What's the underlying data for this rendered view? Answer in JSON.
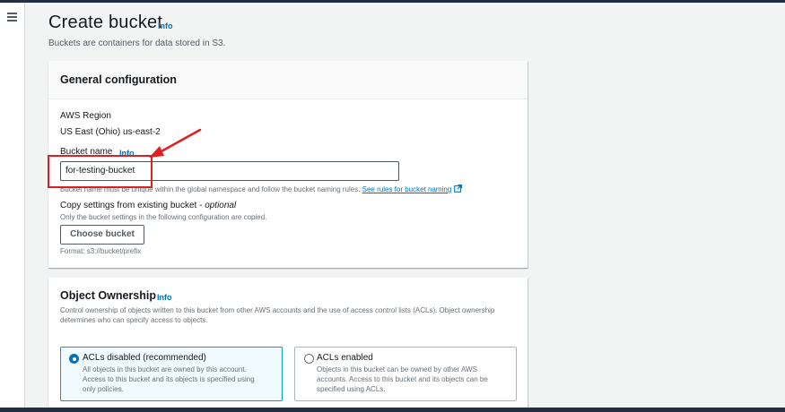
{
  "page": {
    "title": "Create bucket",
    "title_info": "Info",
    "description": "Buckets are containers for data stored in S3."
  },
  "general": {
    "heading": "General configuration",
    "region_label": "AWS Region",
    "region_value": "US East (Ohio) us-east-2",
    "bucket_name_label": "Bucket name",
    "bucket_name_info": "Info",
    "bucket_name_value": "for-testing-bucket",
    "bucket_name_hint": "Bucket name must be unique within the global namespace and follow the bucket naming rules.",
    "naming_rules_link": "See rules for bucket naming",
    "copy_label": "Copy settings from existing bucket - ",
    "copy_optional": "optional",
    "copy_desc": "Only the bucket settings in the following configuration are copied.",
    "choose_button": "Choose bucket",
    "format": "Format: s3://bucket/prefix"
  },
  "ownership": {
    "heading": "Object Ownership",
    "info": "Info",
    "description_line1": "Control ownership of objects written to this bucket from other AWS accounts and the use of access control lists (ACLs). Object ownership",
    "description_line2": "determines who can specify access to objects.",
    "options": [
      {
        "title": "ACLs disabled (recommended)",
        "selected": true,
        "desc1": "All objects in this bucket are owned by this account.",
        "desc2": "Access to this bucket and its objects is specified using",
        "desc3": "only policies."
      },
      {
        "title": "ACLs enabled",
        "selected": false,
        "desc1": "Objects in this bucket can be owned by other AWS",
        "desc2": "accounts. Access to this bucket and its objects can be",
        "desc3": "specified using ACLs."
      }
    ]
  },
  "colors": {
    "accent": "#0073bb",
    "annotation": "#e02020",
    "topbar": "#232f3e"
  },
  "icons": [
    "menu-icon",
    "external-link-icon"
  ]
}
